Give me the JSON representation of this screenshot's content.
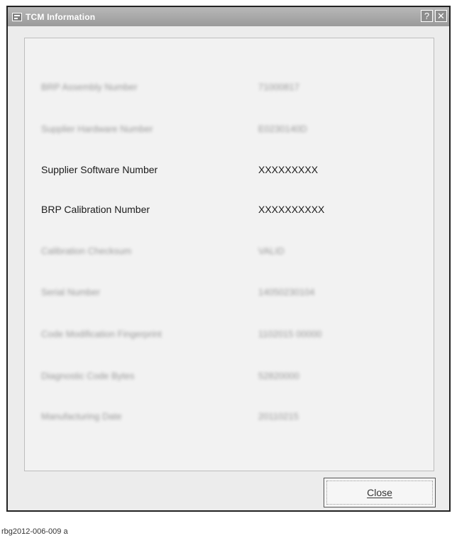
{
  "window": {
    "title": "TCM Information",
    "help_label": "?",
    "close_glyph": "✕"
  },
  "rows": [
    {
      "label": "BRP Assembly Number",
      "value": "71000817",
      "clarity": "blurred"
    },
    {
      "label": "Supplier Hardware Number",
      "value": "E0230140D",
      "clarity": "blurred"
    },
    {
      "label": "Supplier Software Number",
      "value": "XXXXXXXXX",
      "clarity": "sharp"
    },
    {
      "label": "BRP Calibration Number",
      "value": "XXXXXXXXXX",
      "clarity": "sharp"
    },
    {
      "label": "Calibration Checksum",
      "value": "VALID",
      "clarity": "blurred"
    },
    {
      "label": "Serial Number",
      "value": "14050230104",
      "clarity": "blurred"
    },
    {
      "label": "Code Modification Fingerprint",
      "value": "1102015 00000",
      "clarity": "blurred"
    },
    {
      "label": "Diagnostic Code Bytes",
      "value": "52820000",
      "clarity": "blurred"
    },
    {
      "label": "Manufacturing Date",
      "value": "20110215",
      "clarity": "blurred"
    }
  ],
  "footer": {
    "close_label": "Close"
  },
  "caption": "rbg2012-006-009   a"
}
